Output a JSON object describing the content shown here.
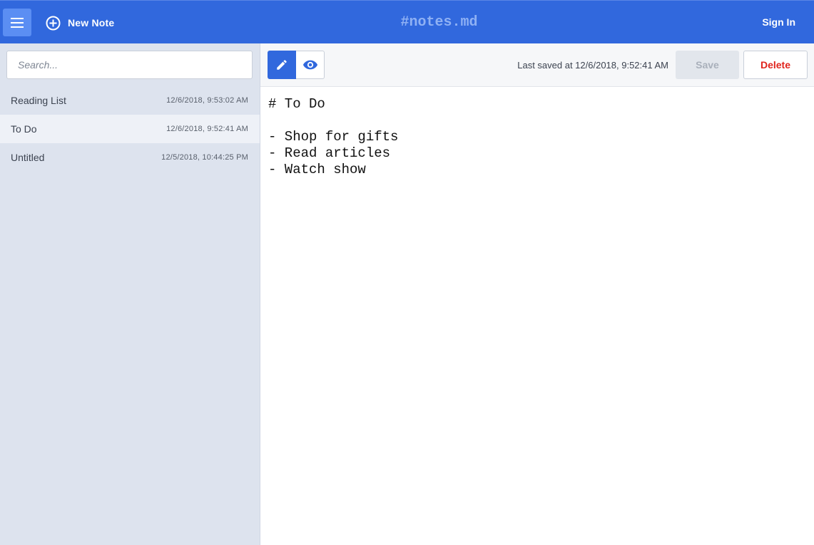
{
  "header": {
    "menu_icon": "hamburger-icon",
    "new_note_icon": "plus-circle-icon",
    "new_note_label": "New Note",
    "brand": "#notes.md",
    "sign_in_label": "Sign In",
    "colors": {
      "bar": "#3168dd",
      "brand": "#8fb1f4"
    }
  },
  "sidebar": {
    "search_placeholder": "Search...",
    "notes": [
      {
        "title": "Reading List",
        "date": "12/6/2018, 9:53:02 AM"
      },
      {
        "title": "To Do",
        "date": "12/6/2018, 9:52:41 AM",
        "active": true
      },
      {
        "title": "Untitled",
        "date": "12/5/2018, 10:44:25 PM"
      }
    ]
  },
  "toolbar": {
    "edit_icon": "pencil-icon",
    "preview_icon": "eye-icon",
    "last_saved": "Last saved at 12/6/2018, 9:52:41 AM",
    "save_label": "Save",
    "delete_label": "Delete",
    "delete_color": "#e0231c"
  },
  "editor": {
    "content": "# To Do\n\n- Shop for gifts\n- Read articles\n- Watch show"
  }
}
